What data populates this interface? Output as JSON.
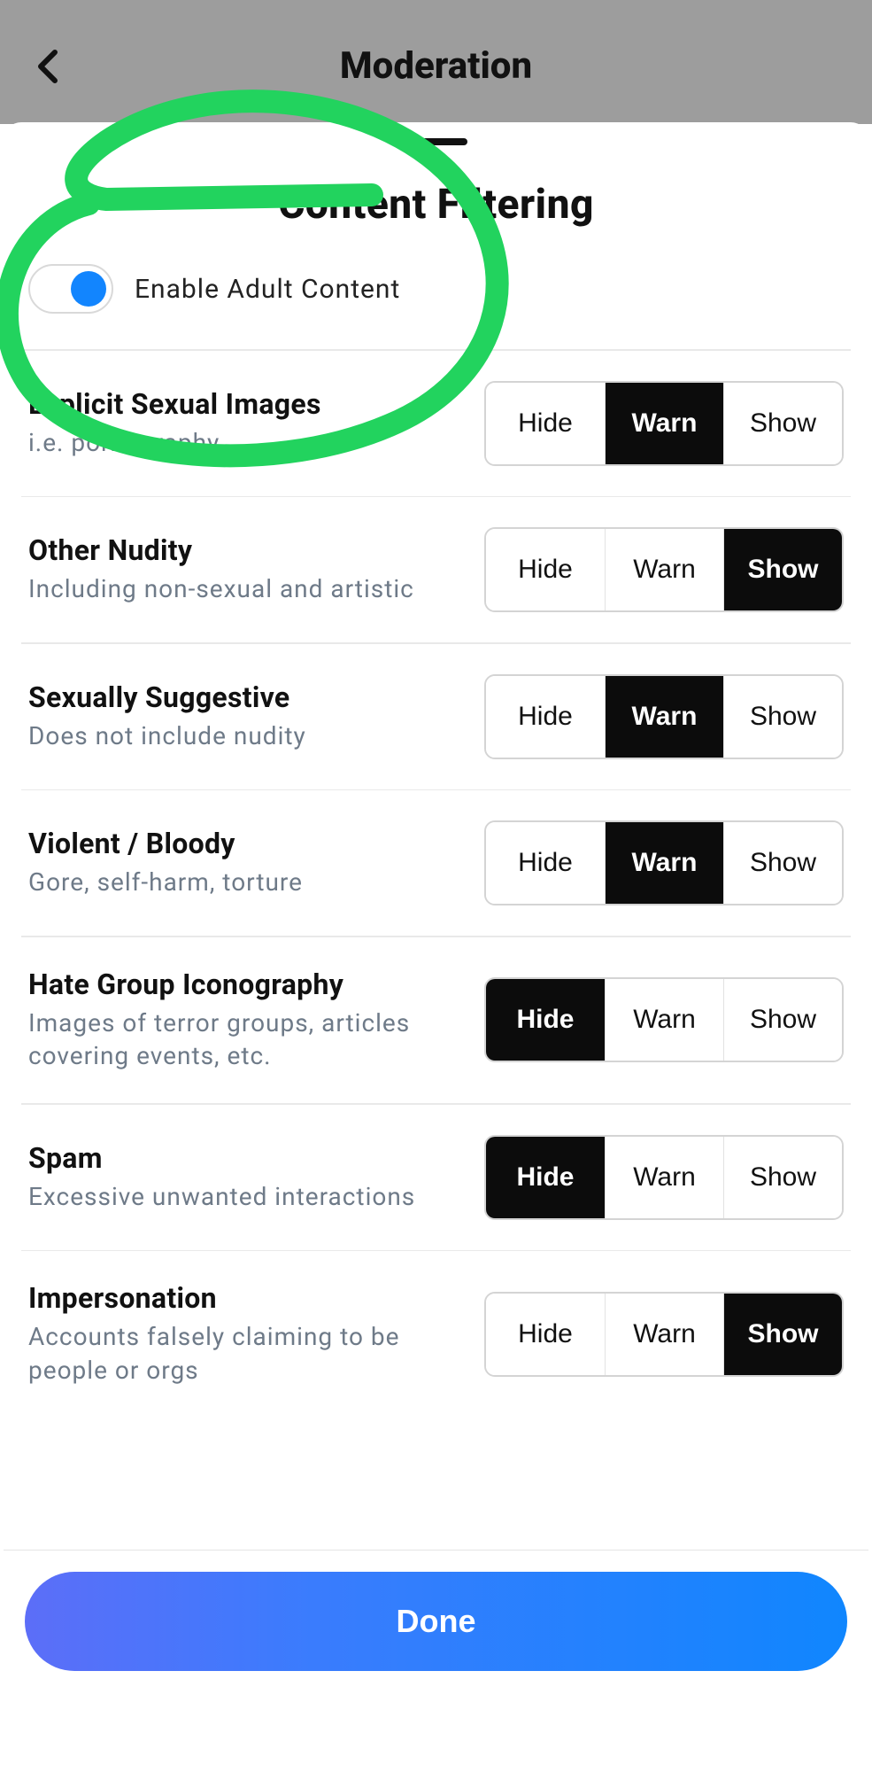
{
  "backdrop": {
    "title": "Moderation"
  },
  "sheet": {
    "title": "Content Filtering",
    "toggle": {
      "label": "Enable Adult Content",
      "enabled": true
    },
    "options": {
      "hide": "Hide",
      "warn": "Warn",
      "show": "Show"
    },
    "categories": [
      {
        "title": "Explicit Sexual Images",
        "desc": "i.e. pornography",
        "selected": "warn"
      },
      {
        "title": "Other Nudity",
        "desc": "Including non-sexual and artistic",
        "selected": "show"
      },
      {
        "title": "Sexually Suggestive",
        "desc": "Does not include nudity",
        "selected": "warn"
      },
      {
        "title": "Violent / Bloody",
        "desc": "Gore, self-harm, torture",
        "selected": "warn"
      },
      {
        "title": "Hate Group Iconography",
        "desc": "Images of terror groups, articles covering events, etc.",
        "selected": "hide"
      },
      {
        "title": "Spam",
        "desc": "Excessive unwanted interactions",
        "selected": "hide"
      },
      {
        "title": "Impersonation",
        "desc": "Accounts falsely claiming to be people or orgs",
        "selected": "show"
      }
    ],
    "done": "Done"
  },
  "annotation": {
    "color": "#2ecc71"
  }
}
